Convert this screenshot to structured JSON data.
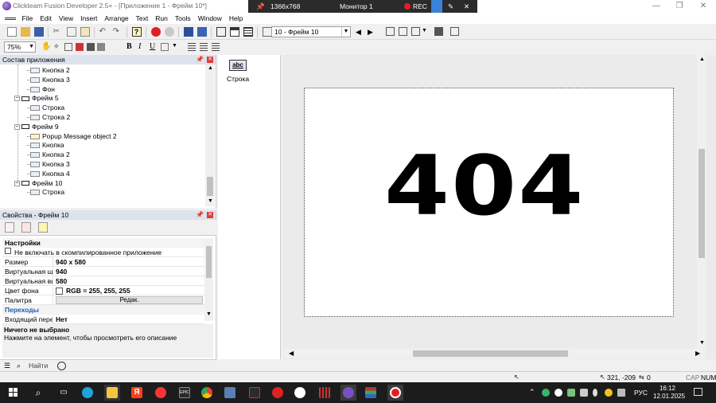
{
  "title_bar": {
    "text": "Clickteam Fusion Developer 2.5+ - [Приложение 1 - Фрейм 10*]"
  },
  "recorder": {
    "resolution": "1366x768",
    "monitor": "Монитор 1",
    "rec_label": "REC"
  },
  "menu": [
    "File",
    "Edit",
    "View",
    "Insert",
    "Arrange",
    "Text",
    "Run",
    "Tools",
    "Window",
    "Help"
  ],
  "toolbar": {
    "frame_select": "10 - Фрейм 10",
    "zoom": "75%"
  },
  "workspace": {
    "title": "Состав приложения",
    "tree": [
      {
        "label": "Кнопка 2",
        "level": 2,
        "kind": "object"
      },
      {
        "label": "Кнопка 3",
        "level": 2,
        "kind": "object"
      },
      {
        "label": "Фон",
        "level": 2,
        "kind": "object"
      },
      {
        "label": "Фрейм 5",
        "level": 1,
        "kind": "frame"
      },
      {
        "label": "Строка",
        "level": 2,
        "kind": "object"
      },
      {
        "label": "Строка 2",
        "level": 2,
        "kind": "object"
      },
      {
        "label": "Фрейм 9",
        "level": 1,
        "kind": "frame"
      },
      {
        "label": "Popup Message object 2",
        "level": 2,
        "kind": "message"
      },
      {
        "label": "Кнопка",
        "level": 2,
        "kind": "object"
      },
      {
        "label": "Кнопка 2",
        "level": 2,
        "kind": "object"
      },
      {
        "label": "Кнопка 3",
        "level": 2,
        "kind": "object"
      },
      {
        "label": "Кнопка 4",
        "level": 2,
        "kind": "object"
      },
      {
        "label": "Фрейм 10",
        "level": 1,
        "kind": "frame"
      },
      {
        "label": "Строка",
        "level": 2,
        "kind": "object"
      }
    ]
  },
  "properties": {
    "title": "Свойства - Фрейм 10",
    "section_settings": "Настройки",
    "exclude_label": "Не включать в скомпилированное приложение",
    "rows": [
      {
        "key": "Размер",
        "value": "940 x 580"
      },
      {
        "key": "Виртуальная ширина",
        "value": "940"
      },
      {
        "key": "Виртуальная высота",
        "value": "580"
      }
    ],
    "bg_color_key": "Цвет фона",
    "bg_color_value": "RGB = 255, 255, 255",
    "palette_key": "Палитра",
    "palette_button": "Редак.",
    "section_transitions": "Переходы",
    "transition_key": "Входящий переход",
    "transition_value": "Нет",
    "description_title": "Ничего не выбрано",
    "description_text": "Нажмите на элемент, чтобы просмотреть его описание"
  },
  "objects_panel": {
    "item_label": "Строка",
    "item_icon_text": "abc"
  },
  "frame_editor": {
    "canvas_text": "404"
  },
  "bottom_bar": {
    "search_placeholder": "Найти"
  },
  "status_bar": {
    "caps": "CAP",
    "num": "NUM",
    "coords": "321, -209",
    "count": "0"
  },
  "taskbar": {
    "language": "РУС",
    "time": "16:12",
    "date": "12.01.2025"
  },
  "colors": {
    "accent_rec": "#e51c23",
    "panel_header": "#dde3ec",
    "link_blue": "#1a5fb4",
    "taskbar_bg": "#1c1c1c"
  }
}
